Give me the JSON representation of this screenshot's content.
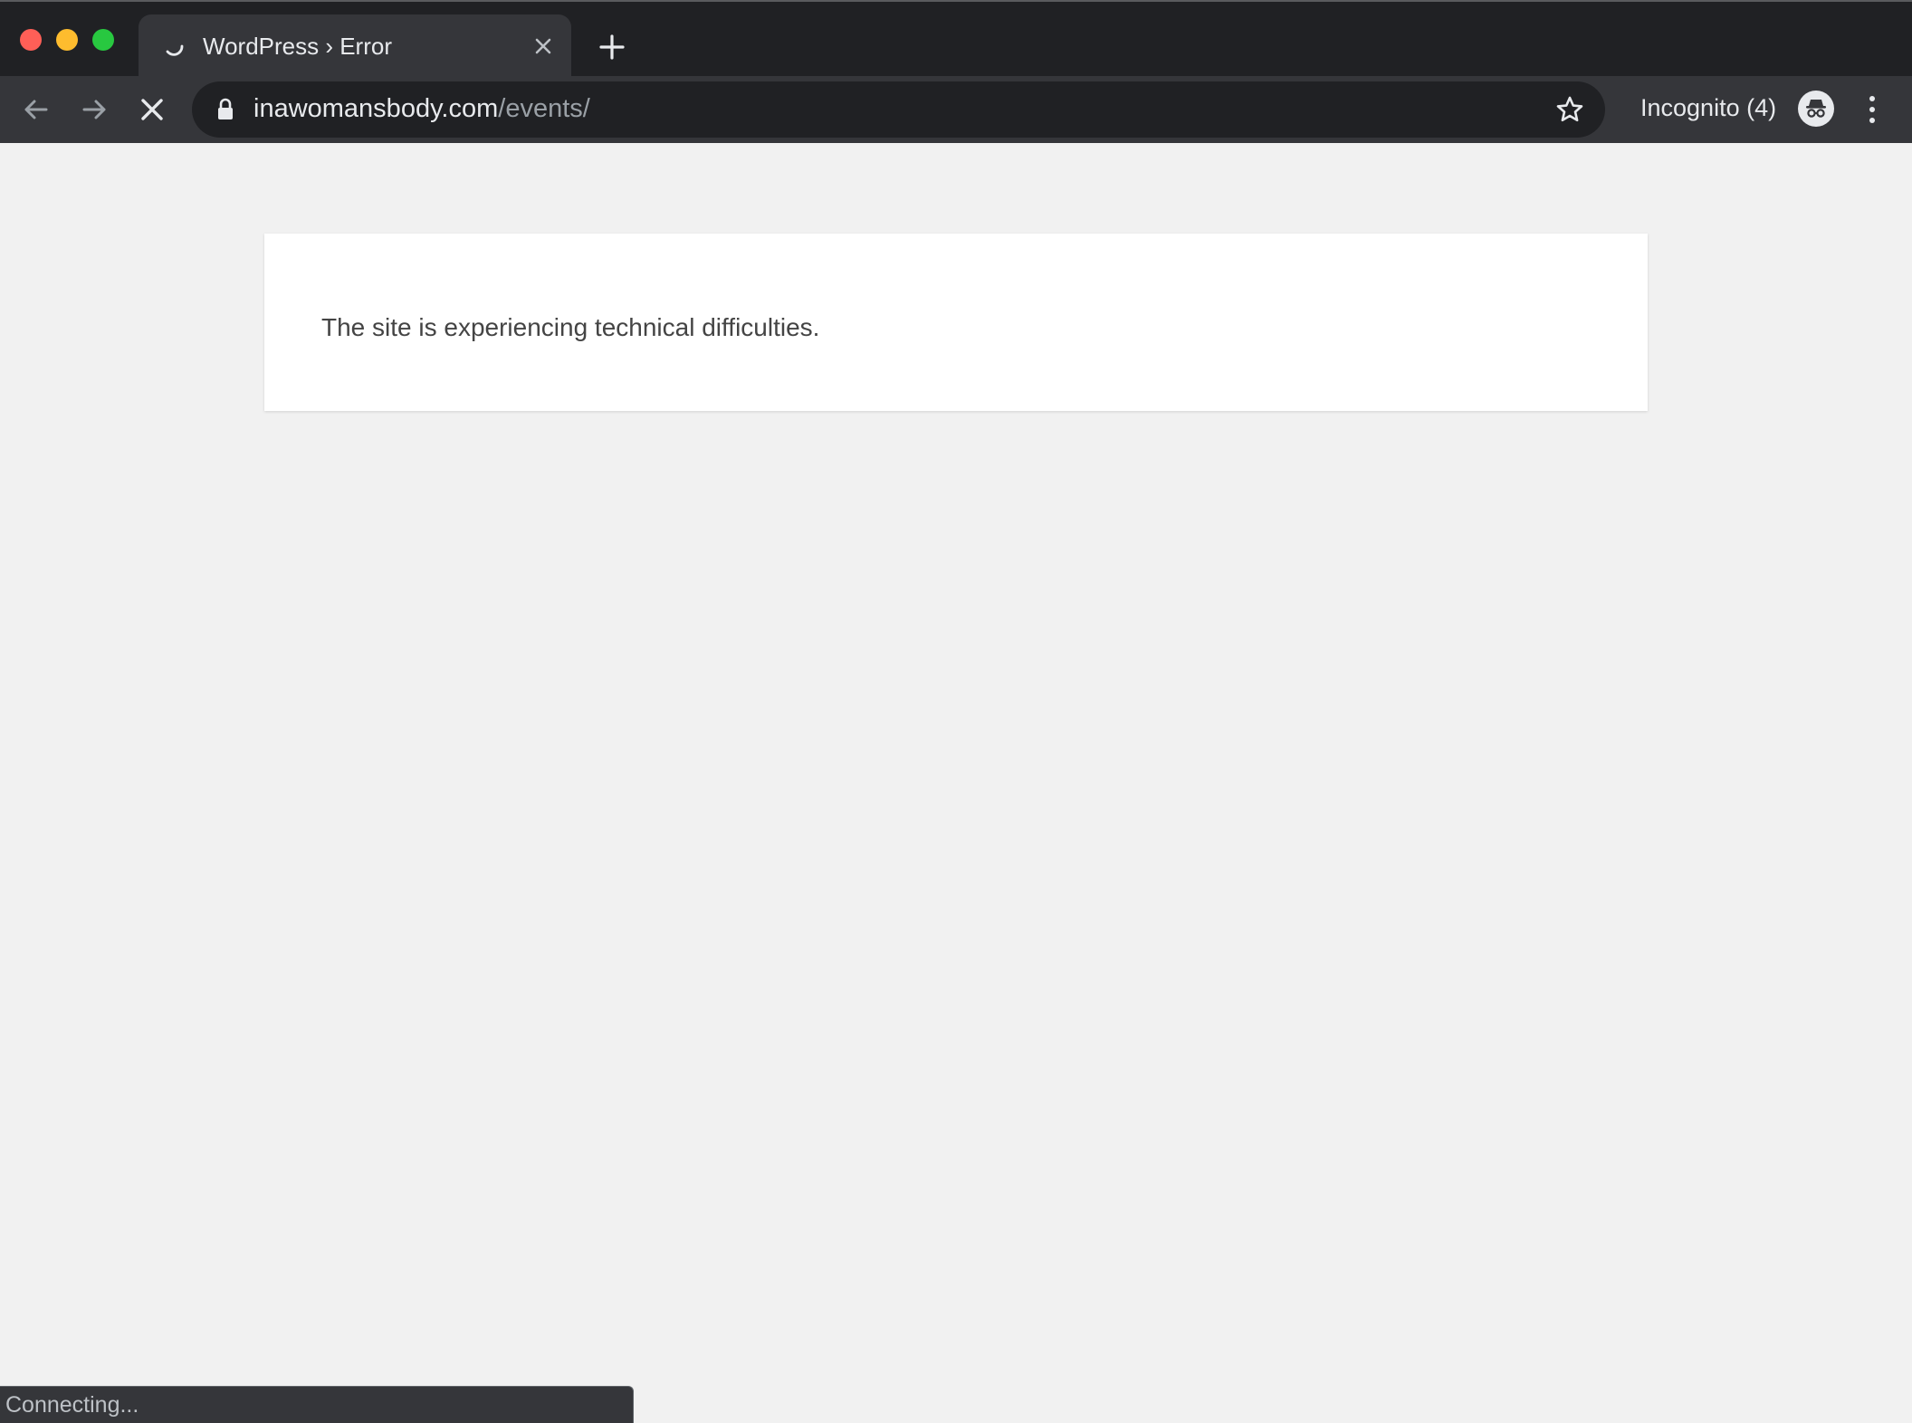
{
  "tab": {
    "title": "WordPress › Error",
    "loading_icon": "spinner-icon",
    "close_icon": "close-icon"
  },
  "toolbar": {
    "url_host": "inawomansbody.com",
    "url_path": "/events/",
    "incognito_label": "Incognito (4)",
    "icons": [
      "back-arrow-icon",
      "forward-arrow-icon",
      "stop-loading-icon",
      "lock-icon",
      "star-icon",
      "incognito-icon",
      "kebab-menu-icon"
    ]
  },
  "page": {
    "error_message": "The site is experiencing technical difficulties."
  },
  "status_bar": {
    "text": "Connecting..."
  },
  "colors": {
    "tabstrip_bg": "#202124",
    "toolbar_bg": "#35363a",
    "page_bg": "#f1f1f1",
    "traffic_close": "#ff5f57",
    "traffic_minimize": "#febc2e",
    "traffic_maximize": "#28c840"
  }
}
